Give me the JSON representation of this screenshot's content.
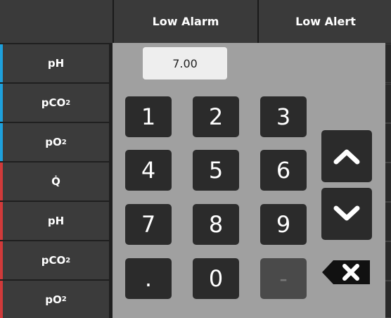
{
  "header": {
    "low_alarm": "Low Alarm",
    "low_alert": "Low Alert"
  },
  "rows": [
    {
      "base": "pH",
      "sub": "",
      "group": "blue"
    },
    {
      "base": "pCO",
      "sub": "2",
      "group": "blue"
    },
    {
      "base": "pO",
      "sub": "2",
      "group": "blue"
    },
    {
      "base": "Q̇",
      "sub": "",
      "group": "red"
    },
    {
      "base": "pH",
      "sub": "",
      "group": "red"
    },
    {
      "base": "pCO",
      "sub": "2",
      "group": "red"
    },
    {
      "base": "pO",
      "sub": "2",
      "group": "red"
    }
  ],
  "low_alarm_value": "7.00",
  "low_alert_value": "---",
  "keypad": {
    "keys": [
      "1",
      "2",
      "3",
      "4",
      "5",
      "6",
      "7",
      "8",
      "9",
      ".",
      "0",
      "-"
    ],
    "up_icon": "chevron-up-icon",
    "down_icon": "chevron-down-icon",
    "backspace_icon": "backspace-icon"
  },
  "colors": {
    "blue_group": "#1ea0dc",
    "red_group": "#d03a3a",
    "keypad_bg": "#a0a0a0",
    "key_bg": "#2b2b2b"
  }
}
